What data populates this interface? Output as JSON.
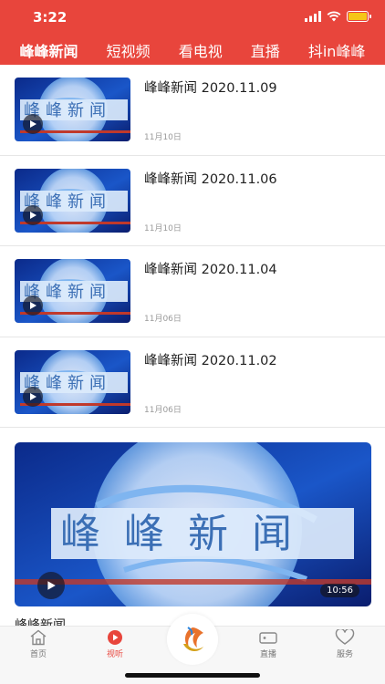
{
  "status_bar": {
    "time": "3:22"
  },
  "tabs": [
    {
      "label": "峰峰新闻",
      "active": true
    },
    {
      "label": "短视频",
      "active": false
    },
    {
      "label": "看电视",
      "active": false
    },
    {
      "label": "直播",
      "active": false
    },
    {
      "label": "抖in峰峰",
      "active": false
    }
  ],
  "news": [
    {
      "title": "峰峰新闻 2020.11.09",
      "date": "11月10日",
      "thumb_text": "峰峰新闻"
    },
    {
      "title": "峰峰新闻 2020.11.06",
      "date": "11月10日",
      "thumb_text": "峰峰新闻"
    },
    {
      "title": "峰峰新闻 2020.11.04",
      "date": "11月06日",
      "thumb_text": "峰峰新闻"
    },
    {
      "title": "峰峰新闻 2020.11.02",
      "date": "11月06日",
      "thumb_text": "峰峰新闻"
    }
  ],
  "featured": {
    "thumb_text": "峰峰新闻",
    "duration": "10:56",
    "caption": "峰峰新闻"
  },
  "bottom_nav": [
    {
      "label": "首页",
      "icon": "home-icon",
      "active": false
    },
    {
      "label": "视听",
      "icon": "play-circle-icon",
      "active": true
    },
    {
      "label": "",
      "icon": "app-logo-icon",
      "active": false
    },
    {
      "label": "直播",
      "icon": "video-camera-icon",
      "active": false
    },
    {
      "label": "服务",
      "icon": "heart-icon",
      "active": false
    }
  ],
  "colors": {
    "brand_red": "#e8453c",
    "text_dark": "#222222",
    "text_muted": "#9a9a9a"
  }
}
